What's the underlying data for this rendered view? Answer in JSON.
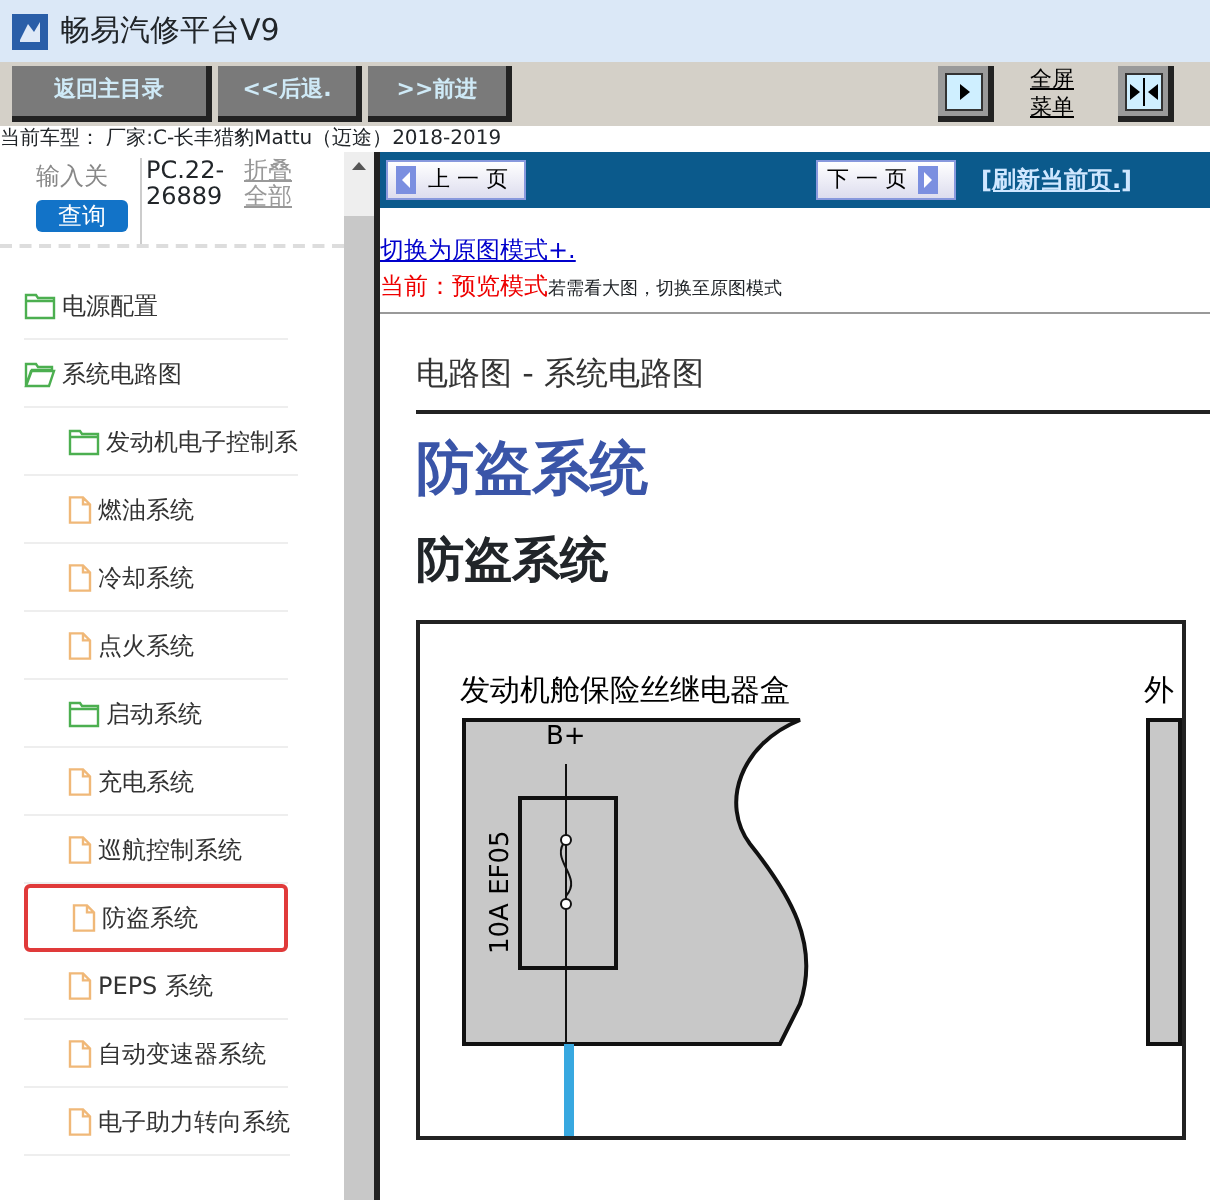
{
  "window": {
    "title": "畅易汽修平台V9"
  },
  "toolbar": {
    "buttons": [
      "返回主目录",
      "<<后退.",
      ">>前进"
    ],
    "menu_link": "全屏菜单"
  },
  "current_model": "当前车型： 厂家:C-长丰猎豹Mattu（迈途）2018-2019",
  "sidebar": {
    "search": {
      "placeholder": "输入关",
      "button": "查询"
    },
    "code": "PC.22-26889",
    "collapse": "折叠全部",
    "tree": [
      {
        "label": "电源配置",
        "kind": "folder",
        "expanded": false,
        "selected": false
      },
      {
        "label": "系统电路图",
        "kind": "folder",
        "expanded": true,
        "selected": false,
        "children": [
          {
            "label": "发动机电子控制系",
            "kind": "folder",
            "expanded": false,
            "selected": false
          },
          {
            "label": "燃油系统",
            "kind": "file",
            "selected": false
          },
          {
            "label": "冷却系统",
            "kind": "file",
            "selected": false
          },
          {
            "label": "点火系统",
            "kind": "file",
            "selected": false
          },
          {
            "label": "启动系统",
            "kind": "folder",
            "expanded": false,
            "selected": false
          },
          {
            "label": "充电系统",
            "kind": "file",
            "selected": false
          },
          {
            "label": "巡航控制系统",
            "kind": "file",
            "selected": false
          },
          {
            "label": "防盗系统",
            "kind": "file",
            "selected": true
          },
          {
            "label": "PEPS 系统",
            "kind": "file",
            "selected": false
          },
          {
            "label": "自动变速器系统",
            "kind": "file",
            "selected": false
          },
          {
            "label": "电子助力转向系统",
            "kind": "file",
            "selected": false
          }
        ]
      }
    ]
  },
  "content": {
    "nav": {
      "prev": "上 一 页",
      "next": "下 一 页",
      "refresh": "[刷新当前页.]"
    },
    "mode_link": "切换为原图模式+.",
    "mode_status": "当前：预览模式",
    "mode_hint": "若需看大图，切换至原图模式",
    "breadcrumb": "电路图 - 系统电路图",
    "title": "防盗系统",
    "subtitle": "防盗系统",
    "diagram": {
      "box_label": "发动机舱保险丝继电器盒",
      "terminal": "B+",
      "fuse": "10A  EF05",
      "cut_label": "外"
    }
  }
}
